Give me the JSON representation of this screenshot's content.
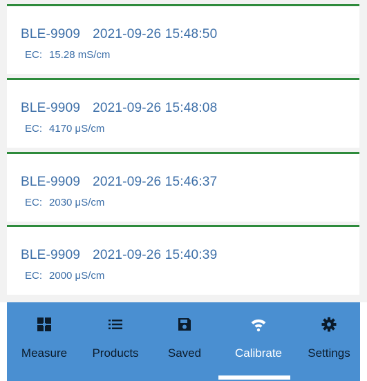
{
  "records": [
    {
      "device": "BLE-9909",
      "timestamp": "2021-09-26 15:48:50",
      "param": "EC:",
      "reading": "15.28 mS/cm"
    },
    {
      "device": "BLE-9909",
      "timestamp": "2021-09-26 15:48:08",
      "param": "EC:",
      "reading": "4170 μS/cm"
    },
    {
      "device": "BLE-9909",
      "timestamp": "2021-09-26 15:46:37",
      "param": "EC:",
      "reading": "2030 μS/cm"
    },
    {
      "device": "BLE-9909",
      "timestamp": "2021-09-26 15:40:39",
      "param": "EC:",
      "reading": "2000 μS/cm"
    }
  ],
  "nav": {
    "items": [
      {
        "label": "Measure",
        "icon": "measure-grid-icon"
      },
      {
        "label": "Products",
        "icon": "list-icon"
      },
      {
        "label": "Saved",
        "icon": "save-disk-icon"
      },
      {
        "label": "Calibrate",
        "icon": "wifi-signal-icon"
      },
      {
        "label": "Settings",
        "icon": "gear-icon"
      }
    ],
    "active_index": 3
  },
  "colors": {
    "nav_background": "#4a8fd1",
    "card_border": "#2e8b3c",
    "text_accent": "#3d6fa8",
    "active_label": "#ffffff"
  }
}
